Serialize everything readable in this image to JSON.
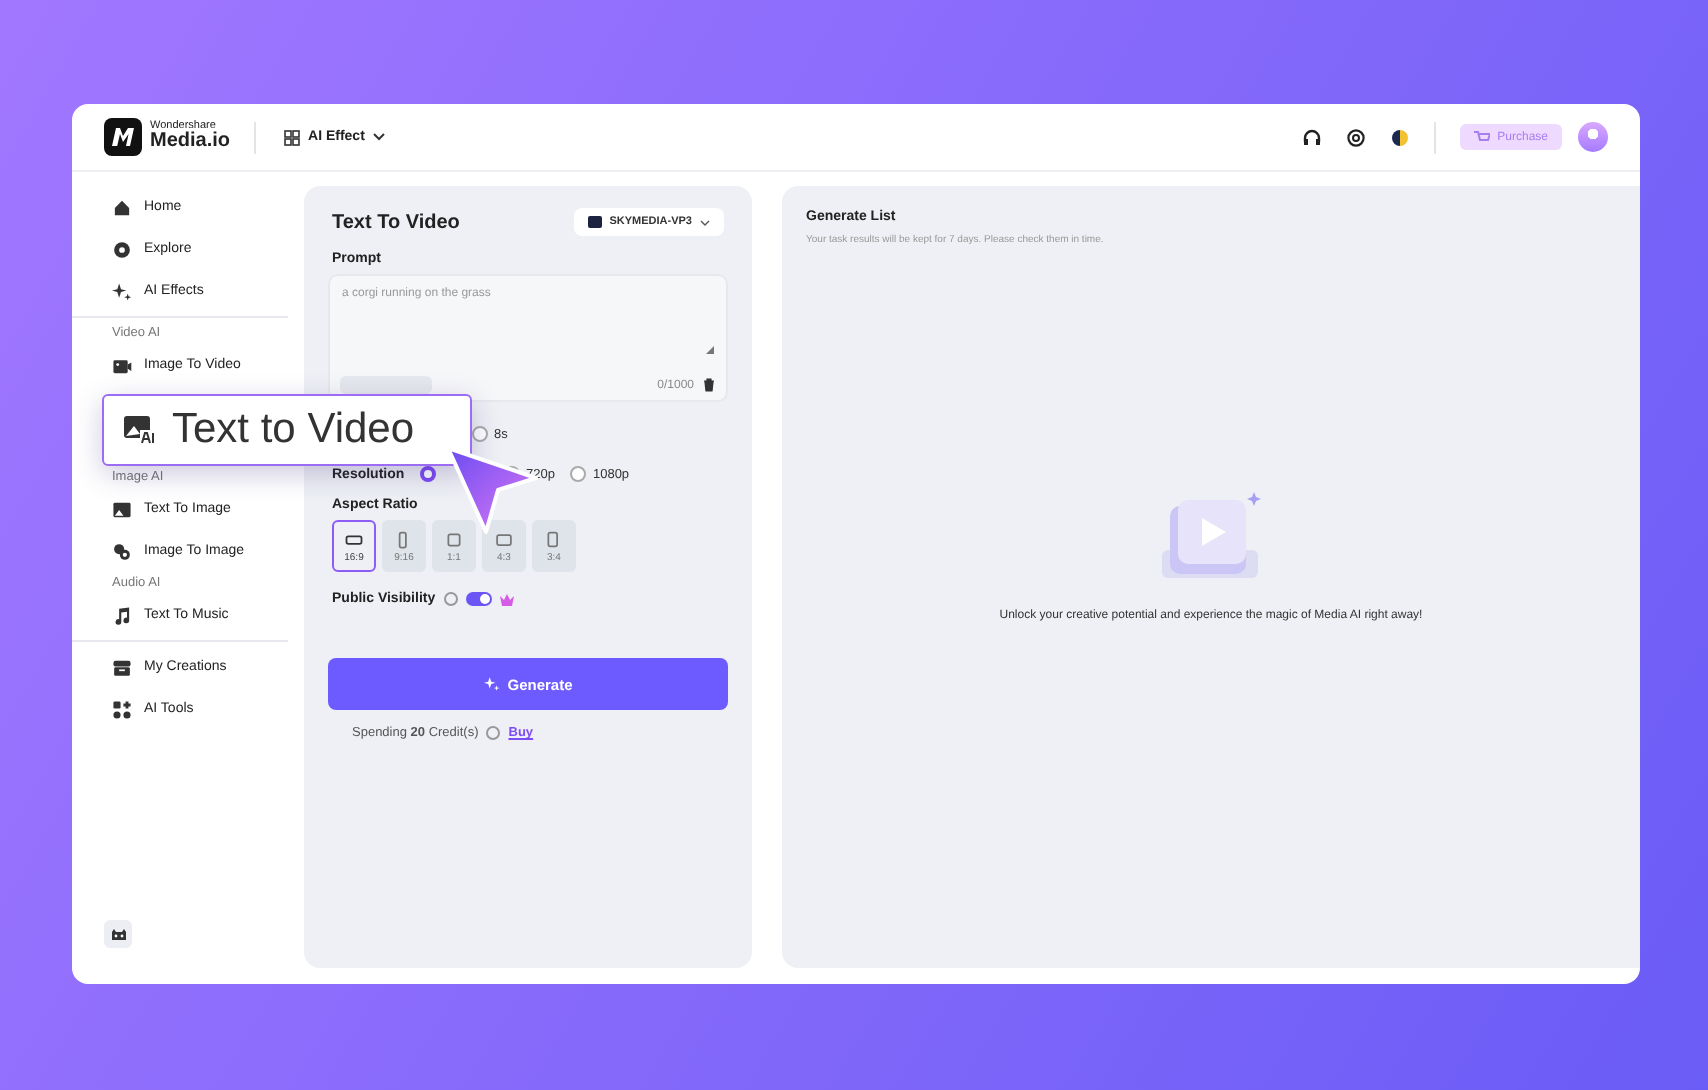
{
  "header": {
    "brand_top": "Wondershare",
    "brand_name": "Media.io",
    "menu": "AI Effect",
    "purchase": "Purchase"
  },
  "sidebar": {
    "groups": [
      {
        "items": [
          {
            "label": "Home"
          },
          {
            "label": "Explore"
          },
          {
            "label": "AI Effects"
          }
        ]
      },
      {
        "heading": "Video AI",
        "items": [
          {
            "label": "Image To Video"
          }
        ]
      },
      {
        "heading": "Image AI",
        "items": [
          {
            "label": "Text To Image"
          },
          {
            "label": "Image To Image"
          }
        ]
      },
      {
        "heading": "Audio AI",
        "items": [
          {
            "label": "Text To Music"
          }
        ]
      },
      {
        "items": [
          {
            "label": "My Creations"
          },
          {
            "label": "AI Tools"
          }
        ]
      }
    ]
  },
  "generator": {
    "title": "Text To Video",
    "model": "SKYMEDIA-VP3",
    "prompt_label": "Prompt",
    "prompt_placeholder": "a corgi running on the grass",
    "counter": "0/1000",
    "duration": {
      "options": [
        {
          "label": "8s",
          "selected": false
        }
      ]
    },
    "resolution": {
      "label": "Resolution",
      "options": [
        {
          "selected": true
        },
        {
          "label": "720p",
          "selected": false
        },
        {
          "label": "1080p",
          "selected": false
        }
      ]
    },
    "aspect_label": "Aspect Ratio",
    "ratios": [
      {
        "label": "16:9",
        "selected": true
      },
      {
        "label": "9:16",
        "selected": false
      },
      {
        "label": "1:1",
        "selected": false
      },
      {
        "label": "4:3",
        "selected": false
      },
      {
        "label": "3:4",
        "selected": false
      }
    ],
    "visibility": {
      "label": "Public Visibility",
      "on": true
    },
    "generate": "Generate",
    "spending": "Spending **20** Credit(s)",
    "buy": "Buy"
  },
  "results": {
    "title": "Generate List",
    "subtitle": "Your task results will be kept for 7 days. Please check them in time.",
    "empty_message": "Unlock your creative potential and experience the magic of Media AI right away!"
  },
  "callout": {
    "label": "Text to Video"
  }
}
